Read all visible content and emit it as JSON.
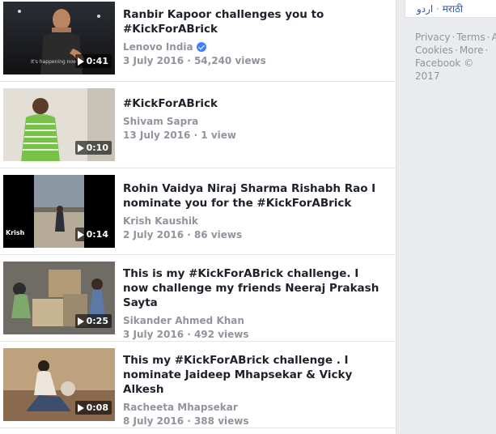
{
  "videos": [
    {
      "title": "Ranbir Kapoor challenges you to #KickForABrick",
      "channel": "Lenovo India",
      "verified": true,
      "meta": "3 July 2016 · 54,240 views",
      "duration": "0:41",
      "thumb_caption": "It's happening now"
    },
    {
      "title": "#KickForABrick",
      "channel": "Shivam Sapra",
      "verified": false,
      "meta": "13 July 2016 · 1 view",
      "duration": "0:10"
    },
    {
      "title": "Rohin Vaidya Niraj Sharma Rishabh Rao I nominate you for the #KickForABrick",
      "channel": "Krish Kaushik",
      "verified": false,
      "meta": "2 July 2016 · 86 views",
      "duration": "0:14",
      "thumb_caption": "Krish"
    },
    {
      "title": "This is my #KickForABrick challenge. I now challenge my friends Neeraj Prakash Sayta",
      "channel": "Sikander Ahmed Khan",
      "verified": false,
      "meta": "3 July 2016 · 492 views",
      "duration": "0:25"
    },
    {
      "title": "This my #KickForABrick challenge . I nominate Jaideep Mhapsekar & Vicky Alkesh",
      "channel": "Racheeta Mhapsekar",
      "verified": false,
      "meta": "8 July 2016 · 388 views",
      "duration": "0:08"
    }
  ],
  "sidebar": {
    "languages": [
      "اردو",
      "मराठी"
    ],
    "footer_links": [
      "Privacy",
      "Terms",
      "A",
      "Cookies",
      "More"
    ],
    "copyright": "Facebook © 2017"
  },
  "colors": {
    "link": "#365899",
    "title": "#1d2129",
    "meta": "#90949c",
    "background": "#e9ebee",
    "verified": "#4080ff"
  }
}
